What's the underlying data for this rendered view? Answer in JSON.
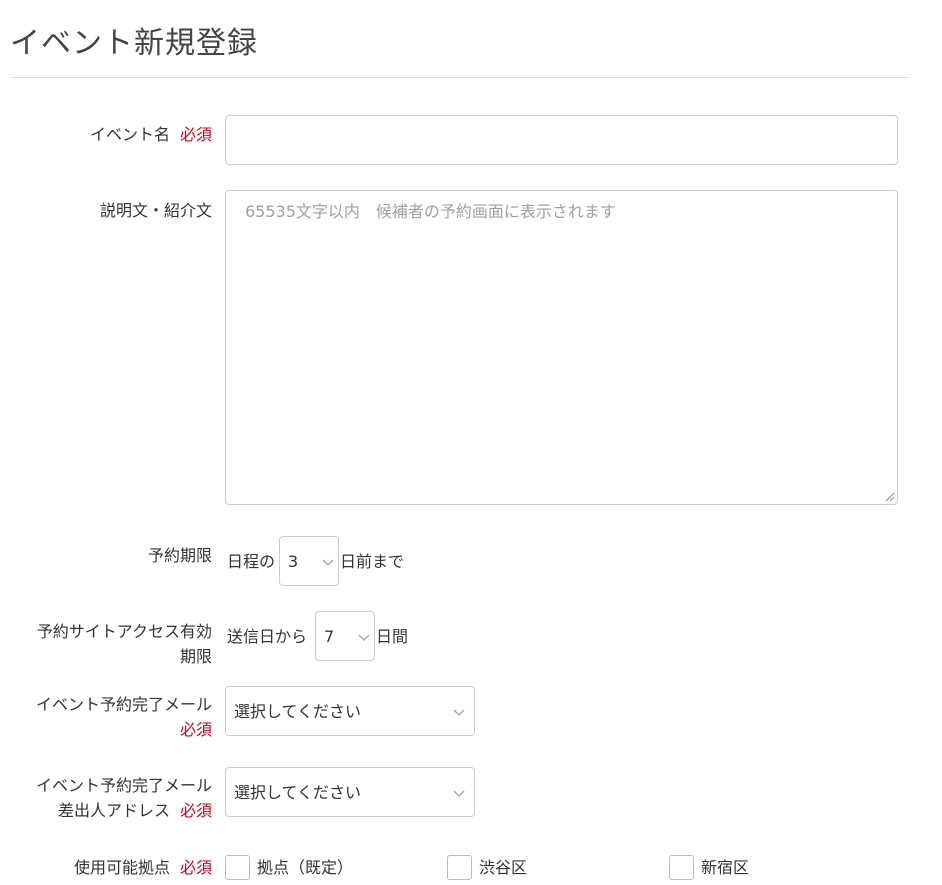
{
  "page": {
    "title": "イベント新規登録"
  },
  "form": {
    "required_mark": "必須",
    "event_name": {
      "label": "イベント名",
      "value": ""
    },
    "description": {
      "label": "説明文・紹介文",
      "placeholder": "65535文字以内　候補者の予約画面に表示されます",
      "value": ""
    },
    "booking_deadline": {
      "label": "予約期限",
      "prefix": "日程の",
      "value": "3",
      "suffix": "日前まで"
    },
    "site_access": {
      "label_line1": "予約サイトアクセス有効",
      "label_line2": "期限",
      "prefix": "送信日から",
      "value": "7",
      "suffix": "日間"
    },
    "completion_mail": {
      "label": "イベント予約完了メール",
      "value": "選択してください"
    },
    "sender_address": {
      "label_line1": "イベント予約完了メール",
      "label_line2": "差出人アドレス",
      "value": "選択してください"
    },
    "locations": {
      "label": "使用可能拠点",
      "options": [
        {
          "label": "拠点（既定）",
          "checked": false
        },
        {
          "label": "渋谷区",
          "checked": false
        },
        {
          "label": "新宿区",
          "checked": false
        }
      ]
    }
  },
  "colors": {
    "required": "#d0021b",
    "border": "#cccccc",
    "placeholder": "#a0a0a0",
    "text": "#333333"
  },
  "icons": {
    "select_arrow": "chevron-down-icon",
    "resize": "resize-grip-icon"
  }
}
